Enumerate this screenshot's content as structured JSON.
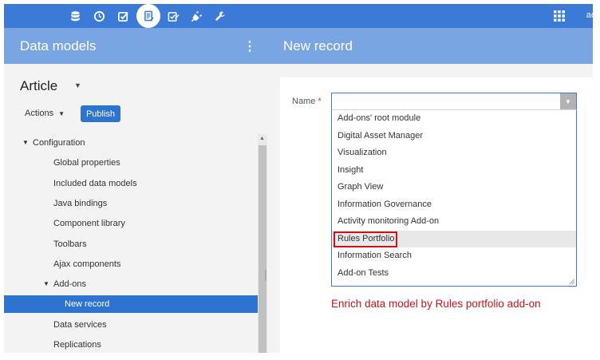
{
  "topbar": {
    "icons": [
      "database-icon",
      "clock-icon",
      "checkbox-icon",
      "data-model-icon",
      "edit-check-icon",
      "plug-icon",
      "wrench-icon"
    ],
    "apps_icon": "apps-grid-icon",
    "user_label": "ad",
    "accent": "#3b7ad6"
  },
  "left_header": {
    "title": "Data models",
    "menu_icon": "⋮"
  },
  "right_header": {
    "title": "New record"
  },
  "left_panel": {
    "model_name": "Article",
    "actions_label": "Actions",
    "publish_label": "Publish",
    "tree": [
      {
        "label": "Configuration",
        "level": 0,
        "expanded": true
      },
      {
        "label": "Global properties",
        "level": 1
      },
      {
        "label": "Included data models",
        "level": 1
      },
      {
        "label": "Java bindings",
        "level": 1
      },
      {
        "label": "Component library",
        "level": 1
      },
      {
        "label": "Toolbars",
        "level": 1
      },
      {
        "label": "Ajax components",
        "level": 1
      },
      {
        "label": "Add-ons",
        "level": 1,
        "expanded": true
      },
      {
        "label": "New record",
        "level": 2,
        "selected": true
      },
      {
        "label": "Data services",
        "level": 1
      },
      {
        "label": "Replications",
        "level": 1
      }
    ]
  },
  "form": {
    "name_label": "Name",
    "required_mark": "*",
    "name_value": "",
    "options": [
      "Add-ons' root module",
      "Digital Asset Manager",
      "Visualization",
      "Insight",
      "Graph View",
      "Information Governance",
      "Activity monitoring Add-on",
      "Rules Portfolio",
      "Information Search",
      "Add-on Tests"
    ],
    "hovered_option": "Rules Portfolio",
    "highlight_color": "#d3101a"
  },
  "caption": "Enrich data model by Rules portfolio add-on"
}
